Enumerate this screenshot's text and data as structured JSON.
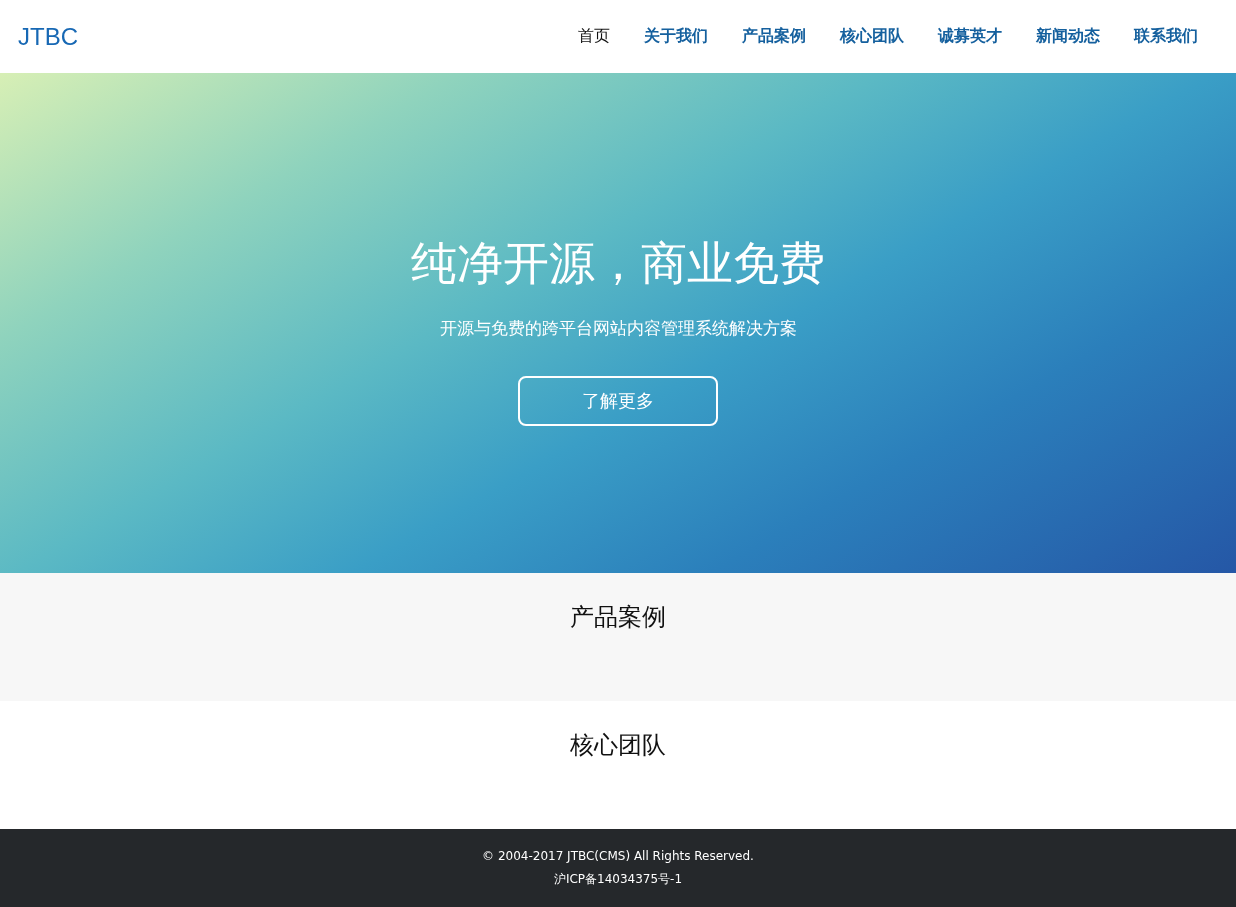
{
  "header": {
    "logo": "JTBC",
    "nav": [
      {
        "label": "首页",
        "selected": true
      },
      {
        "label": "关于我们",
        "selected": false
      },
      {
        "label": "产品案例",
        "selected": false
      },
      {
        "label": "核心团队",
        "selected": false
      },
      {
        "label": "诚募英才",
        "selected": false
      },
      {
        "label": "新闻动态",
        "selected": false
      },
      {
        "label": "联系我们",
        "selected": false
      }
    ]
  },
  "hero": {
    "title": "纯净开源，商业免费",
    "subtitle": "开源与免费的跨平台网站内容管理系统解决方案",
    "button": "了解更多"
  },
  "sections": [
    {
      "title": "产品案例"
    },
    {
      "title": "核心团队"
    }
  ],
  "footer": {
    "copyright": "© 2004-2017 JTBC(CMS) All Rights Reserved.",
    "icp": "沪ICP备14034375号-1"
  }
}
